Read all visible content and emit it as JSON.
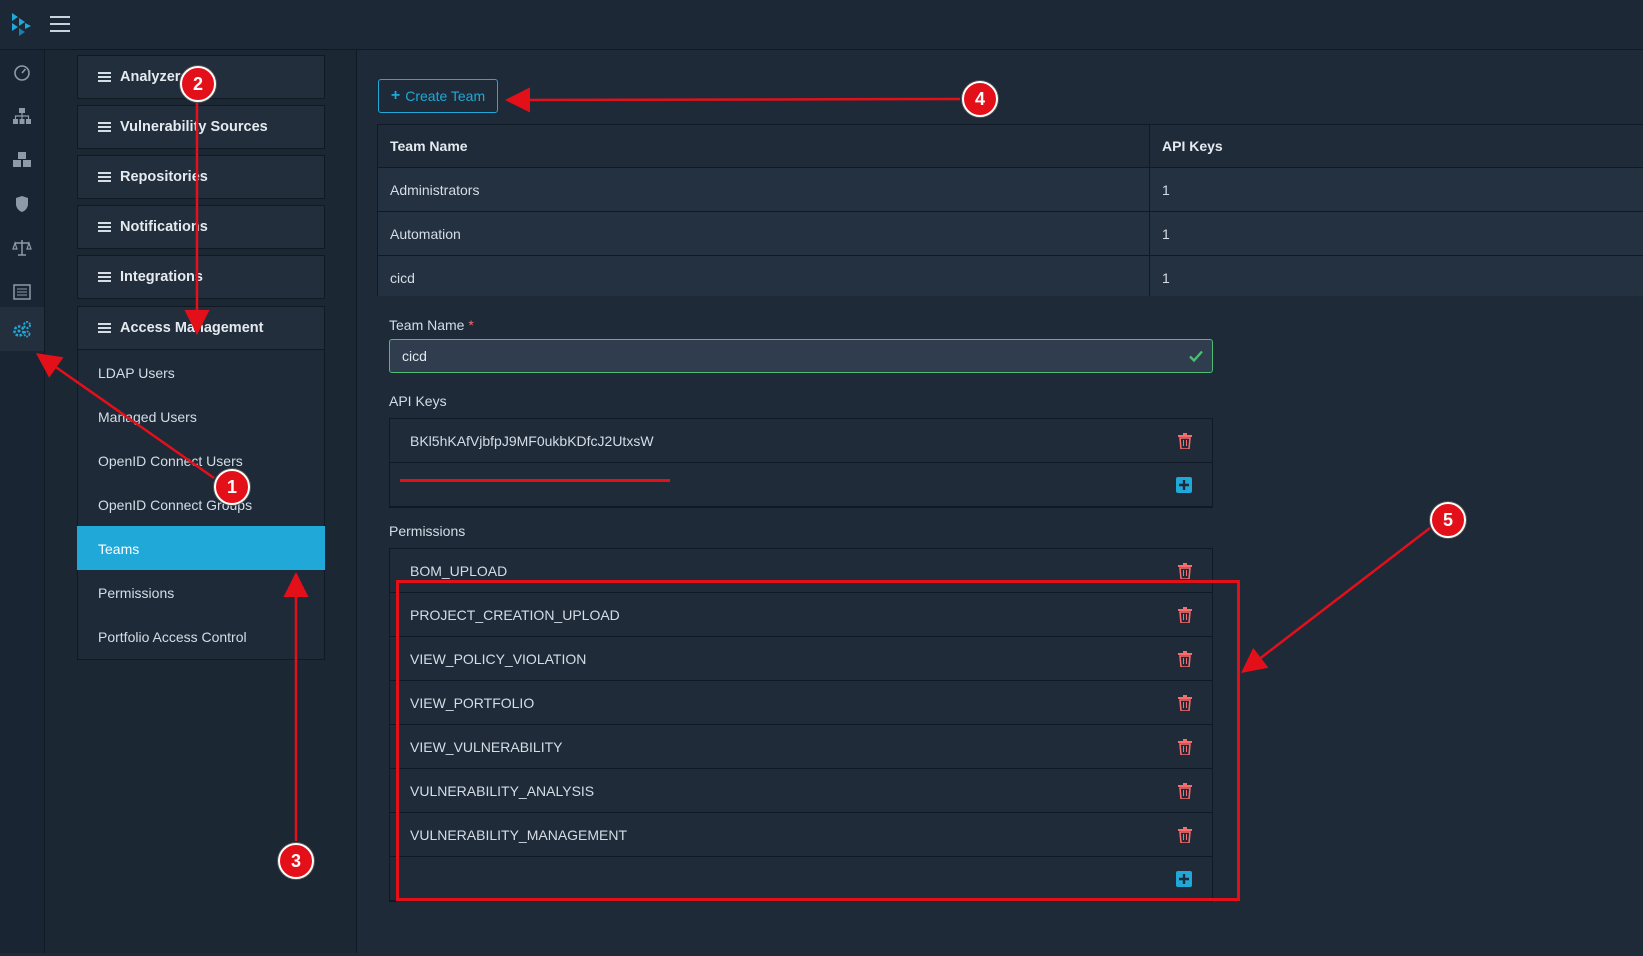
{
  "topbar": {
    "logo": "dependency-track-logo-icon",
    "menu_icon": "hamburger-icon"
  },
  "iconbar": {
    "items": [
      {
        "icon": "dashboard-icon"
      },
      {
        "icon": "sitemap-icon"
      },
      {
        "icon": "cubes-icon"
      },
      {
        "icon": "shield-icon"
      },
      {
        "icon": "balance-scale-icon"
      },
      {
        "icon": "list-alt-icon"
      },
      {
        "icon": "cogs-icon",
        "active": true
      }
    ]
  },
  "settings": {
    "categories": [
      {
        "label": "Analyzers"
      },
      {
        "label": "Vulnerability Sources"
      },
      {
        "label": "Repositories"
      },
      {
        "label": "Notifications"
      },
      {
        "label": "Integrations"
      },
      {
        "label": "Access Management"
      }
    ],
    "access_items": [
      {
        "label": "LDAP Users"
      },
      {
        "label": "Managed Users"
      },
      {
        "label": "OpenID Connect Users"
      },
      {
        "label": "OpenID Connect Groups"
      },
      {
        "label": "Teams",
        "active": true
      },
      {
        "label": "Permissions"
      },
      {
        "label": "Portfolio Access Control"
      }
    ]
  },
  "main": {
    "create_team_label": "Create Team",
    "table": {
      "headers": [
        "Team Name",
        "API Keys"
      ],
      "rows": [
        [
          "Administrators",
          "1"
        ],
        [
          "Automation",
          "1"
        ],
        [
          "cicd",
          "1"
        ]
      ]
    },
    "detail": {
      "team_name_label": "Team Name",
      "required_mark": "*",
      "team_name_value": "cicd",
      "api_keys_label": "API Keys",
      "api_keys": [
        "BKl5hKAfVjbfpJ9MF0ukbKDfcJ2UtxsW"
      ],
      "permissions_label": "Permissions",
      "permissions": [
        "BOM_UPLOAD",
        "PROJECT_CREATION_UPLOAD",
        "VIEW_POLICY_VIOLATION",
        "VIEW_PORTFOLIO",
        "VIEW_VULNERABILITY",
        "VULNERABILITY_ANALYSIS",
        "VULNERABILITY_MANAGEMENT"
      ]
    }
  },
  "annotations": {
    "badges": [
      "1",
      "2",
      "3",
      "4",
      "5"
    ],
    "color": "#e3101a"
  },
  "colors": {
    "accent": "#20a8d8",
    "success": "#4dbd74",
    "danger": "#f86c6b"
  }
}
